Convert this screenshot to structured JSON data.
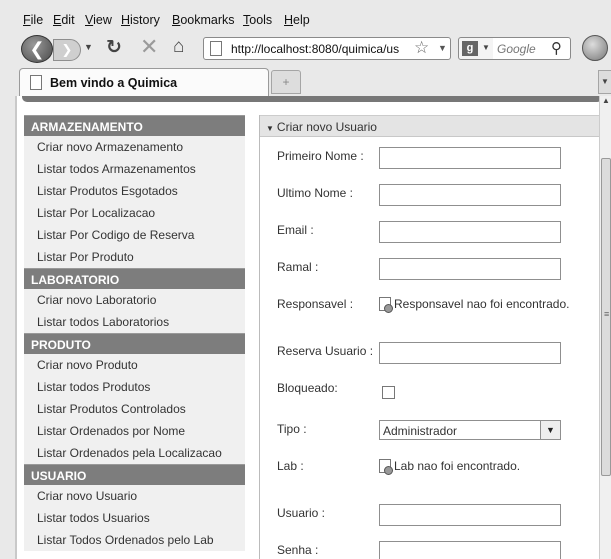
{
  "menu": [
    "File",
    "Edit",
    "View",
    "History",
    "Bookmarks",
    "Tools",
    "Help"
  ],
  "nav": {
    "url": "http://localhost:8080/quimica/us",
    "search_placeholder": "Google"
  },
  "tab": {
    "title": "Bem vindo a Quimica",
    "new_tab": "+"
  },
  "sidebar": {
    "sections": [
      {
        "title": "ARMAZENAMENTO",
        "items": [
          "Criar novo Armazenamento",
          "Listar todos Armazenamentos",
          "Listar Produtos Esgotados",
          "Listar Por Localizacao",
          "Listar Por Codigo de Reserva",
          "Listar Por Produto"
        ]
      },
      {
        "title": "LABORATORIO",
        "items": [
          "Criar novo Laboratorio",
          "Listar todos Laboratorios"
        ]
      },
      {
        "title": "PRODUTO",
        "items": [
          "Criar novo Produto",
          "Listar todos Produtos",
          "Listar Produtos Controlados",
          "Listar Ordenados por Nome",
          "Listar Ordenados pela Localizacao"
        ]
      },
      {
        "title": "USUARIO",
        "items": [
          "Criar novo Usuario",
          "Listar todos Usuarios",
          "Listar Todos Ordenados pelo Lab"
        ]
      }
    ]
  },
  "form": {
    "title": "Criar novo Usuario",
    "primeiro_nome": {
      "label": "Primeiro Nome :",
      "value": ""
    },
    "ultimo_nome": {
      "label": "Ultimo Nome :",
      "value": ""
    },
    "email": {
      "label": "Email :",
      "value": ""
    },
    "ramal": {
      "label": "Ramal :",
      "value": ""
    },
    "responsavel": {
      "label": "Responsavel :",
      "note": "Responsavel nao foi encontrado."
    },
    "reserva_usuario": {
      "label": "Reserva Usuario :",
      "value": ""
    },
    "bloqueado": {
      "label": "Bloqueado:",
      "checked": false
    },
    "tipo": {
      "label": "Tipo :",
      "value": "Administrador"
    },
    "lab": {
      "label": "Lab :",
      "note": "Lab nao foi encontrado."
    },
    "usuario": {
      "label": "Usuario :",
      "value": ""
    },
    "senha": {
      "label": "Senha :",
      "value": ""
    }
  },
  "colors": {
    "section_header": "#7d7d7d",
    "menu_item_bg": "#f0f0f0",
    "chrome_bg": "#e9e9e9"
  }
}
